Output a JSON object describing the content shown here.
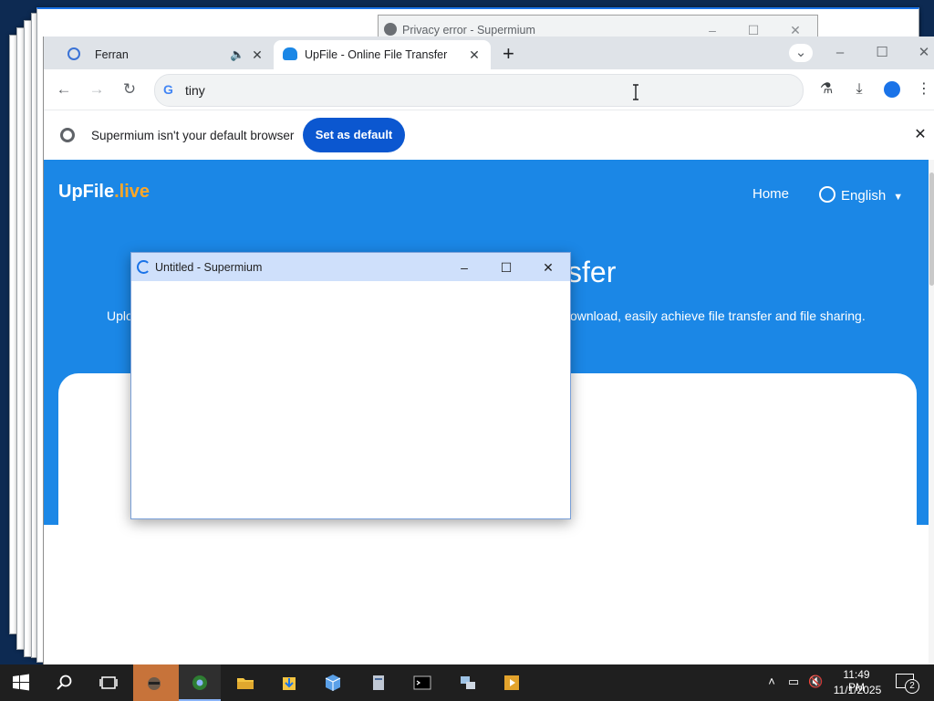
{
  "background_window": {
    "title": "Privacy error - Supermium"
  },
  "browser": {
    "tabs": [
      {
        "label": "Ferran",
        "icon": "edge-favicon-icon",
        "audio_icon": "speaker-icon"
      },
      {
        "label": "UpFile - Online File Transfer",
        "icon": "upload-cloud-icon"
      }
    ],
    "new_tab_label": "+",
    "omnibox_text": "tiny",
    "infobar": {
      "message": "Supermium isn't your default browser",
      "button": "Set as default"
    }
  },
  "site": {
    "logo_main": "UpFile",
    "logo_suffix": ".live",
    "nav_home": "Home",
    "nav_language": "English",
    "hero_title_visible": "sfer",
    "hero_sub_left": "Uplo",
    "hero_sub_right": "ownload, easily achieve file transfer and file sharing."
  },
  "popup": {
    "title": "Untitled - Supermium"
  },
  "taskbar": {
    "time": "11:49 PM",
    "date": "11/1/2025",
    "notification_count": "2"
  },
  "colors": {
    "hero_blue": "#1b87e6",
    "logo_accent": "#ffa726",
    "default_button": "#0b57d0"
  }
}
